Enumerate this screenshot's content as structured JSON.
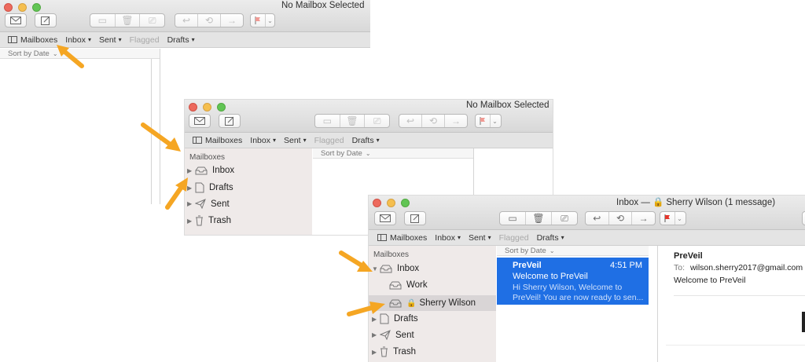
{
  "windows": [
    {
      "title": "No Mailbox Selected",
      "favorites": {
        "mailboxes": "Mailboxes",
        "inbox": "Inbox",
        "sent": "Sent",
        "flagged": "Flagged",
        "drafts": "Drafts"
      },
      "sort_label": "Sort by Date"
    },
    {
      "title": "No Mailbox Selected",
      "favorites": {
        "mailboxes": "Mailboxes",
        "inbox": "Inbox",
        "sent": "Sent",
        "flagged": "Flagged",
        "drafts": "Drafts"
      },
      "sort_label": "Sort by Date",
      "sidebar": {
        "header": "Mailboxes",
        "items": [
          "Inbox",
          "Drafts",
          "Sent",
          "Trash"
        ]
      }
    },
    {
      "title_prefix": "Inbox — ",
      "title_account": "Sherry Wilson",
      "title_suffix": " (1 message)",
      "favorites": {
        "mailboxes": "Mailboxes",
        "inbox": "Inbox",
        "sent": "Sent",
        "flagged": "Flagged",
        "drafts": "Drafts"
      },
      "sort_label": "Sort by Date",
      "sidebar": {
        "header": "Mailboxes",
        "inbox": "Inbox",
        "work": "Work",
        "account": "Sherry Wilson",
        "drafts": "Drafts",
        "sent": "Sent",
        "trash": "Trash"
      },
      "message": {
        "sender": "PreVeil",
        "time": "4:51 PM",
        "subject": "Welcome to PreVeil",
        "preview_line1": "Hi Sherry Wilson, Welcome to",
        "preview_line2": "PreVeil! You are now ready to sen..."
      },
      "reader": {
        "from": "PreVeil",
        "to_label": "To:",
        "to_value": "wilson.sherry2017@gmail.com",
        "subject": "Welcome to PreVeil"
      }
    }
  ],
  "colors": {
    "selection": "#1f6fe4",
    "arrow": "#f5a623",
    "flag": "#e5352b",
    "lock": "#e8a128"
  }
}
